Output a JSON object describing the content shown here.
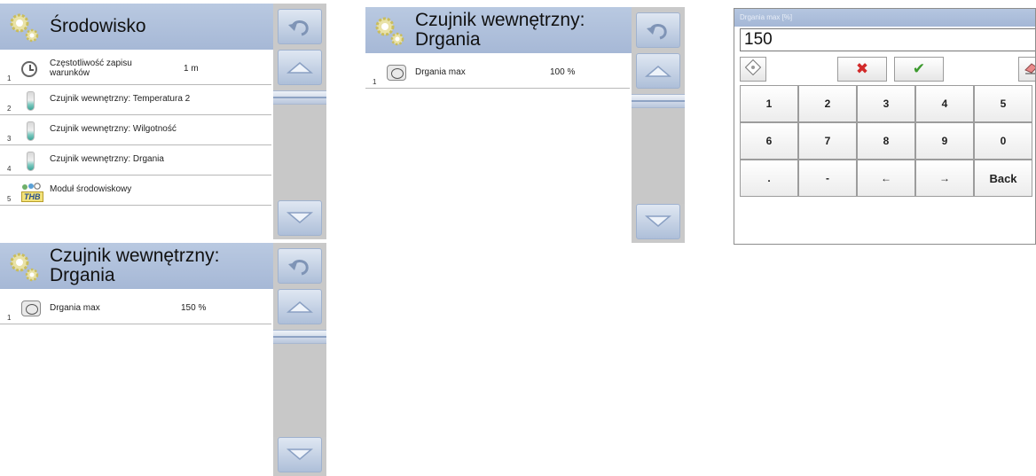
{
  "panel_env": {
    "title": "Środowisko",
    "rows": [
      {
        "index": "1",
        "icon": "clock-icon",
        "label": "Częstotliwość zapisu warunków",
        "value": "1 m"
      },
      {
        "index": "2",
        "icon": "temperature-sensor-icon",
        "label": "Czujnik wewnętrzny: Temperatura 2",
        "value": ""
      },
      {
        "index": "3",
        "icon": "humidity-sensor-icon",
        "label": "Czujnik wewnętrzny: Wilgotność",
        "value": ""
      },
      {
        "index": "4",
        "icon": "vibration-sensor-icon",
        "label": "Czujnik wewnętrzny: Drgania",
        "value": ""
      },
      {
        "index": "5",
        "icon": "environment-module-icon",
        "label": "Moduł środowiskowy",
        "value": "",
        "badge": "THB"
      }
    ]
  },
  "panel_vib_top": {
    "title": "Czujnik wewnętrzny: Drgania",
    "rows": [
      {
        "index": "1",
        "icon": "vibration-icon",
        "label": "Drgania max",
        "value": "100 %"
      }
    ]
  },
  "panel_vib_bottom": {
    "title": "Czujnik wewnętrzny: Drgania",
    "rows": [
      {
        "index": "1",
        "icon": "vibration-icon",
        "label": "Drgania max",
        "value": "150 %"
      }
    ]
  },
  "keypad": {
    "title": "Drgania max [%]",
    "input_value": "150",
    "keys": [
      [
        "1",
        "2",
        "3",
        "4",
        "5"
      ],
      [
        "6",
        "7",
        "8",
        "9",
        "0"
      ],
      [
        ".",
        "-",
        "←",
        "→",
        "Back"
      ]
    ],
    "tools": {
      "left": "keyboard-icon",
      "cancel": "✖",
      "ok": "✔",
      "right": "eraser-icon"
    }
  },
  "colors": {
    "header": "#aebfdb",
    "scrollbar": "#c9c9c9",
    "cancel": "#d22a2a",
    "ok": "#3c9a2e"
  }
}
